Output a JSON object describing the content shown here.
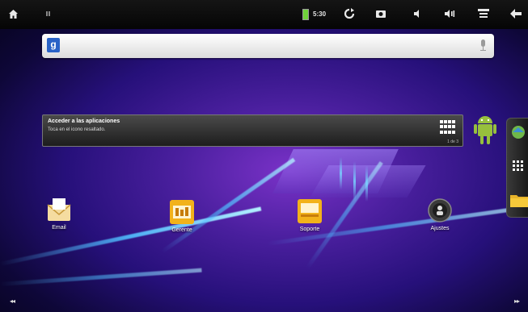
{
  "search": {
    "placeholder": ""
  },
  "status": {
    "time": "5:30"
  },
  "widget": {
    "title": "Acceder a las aplicaciones",
    "text": "Toca en el icono resaltado.",
    "page": "1 de 3"
  },
  "apps": [
    {
      "label": "Email",
      "icon": "email-icon"
    },
    {
      "label": "Gerente",
      "icon": "manager-icon"
    },
    {
      "label": "Soporte",
      "icon": "support-icon"
    },
    {
      "label": "Ajustes",
      "icon": "settings-icon"
    }
  ],
  "colors": {
    "accent_blue": "#2a63c7",
    "android_green": "#97c03d",
    "wallpaper": "#4a1f9e"
  }
}
